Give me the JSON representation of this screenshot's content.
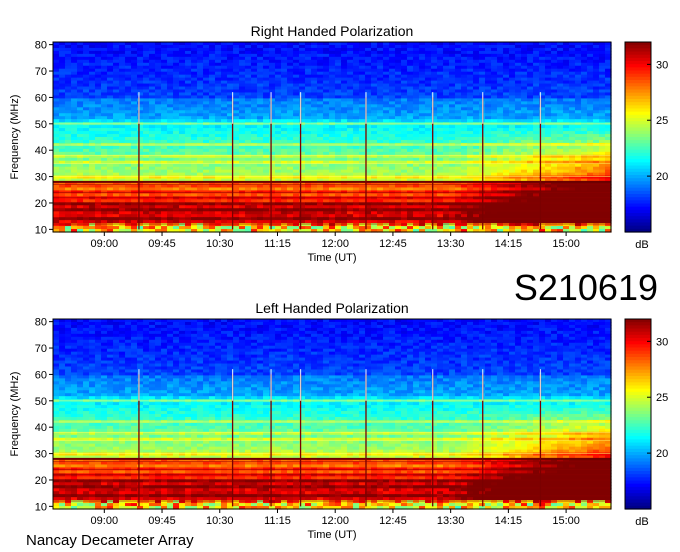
{
  "stamp": "S210619",
  "footer": "Nancay Decameter Array",
  "chart_data": [
    {
      "type": "heatmap",
      "title": "Right Handed Polarization",
      "xlabel": "Time (UT)",
      "ylabel": "Frequency (MHz)",
      "x_range": [
        "08:20",
        "15:35"
      ],
      "x_ticks": [
        "09:00",
        "09:45",
        "10:30",
        "11:15",
        "12:00",
        "12:45",
        "13:30",
        "14:15",
        "15:00"
      ],
      "ylim": [
        9,
        81
      ],
      "y_ticks": [
        10,
        20,
        30,
        40,
        50,
        60,
        70,
        80
      ],
      "colorbar": {
        "label": "dB",
        "range": [
          15,
          32
        ],
        "ticks": [
          20,
          25,
          30
        ],
        "colormap": "jet"
      },
      "features": {
        "strong_band_mhz": [
          10,
          28
        ],
        "bright_lines_mhz": [
          12,
          14,
          17,
          20,
          22,
          24,
          27,
          28,
          30,
          35,
          38,
          42,
          50
        ],
        "dark_above_mhz": 60,
        "vertical_bursts_ut": [
          "09:27",
          "10:40",
          "11:10",
          "11:33",
          "12:24",
          "13:16",
          "13:55",
          "14:40"
        ],
        "late_enhancement_from_ut": "13:30"
      }
    },
    {
      "type": "heatmap",
      "title": "Left Handed Polarization",
      "xlabel": "Time (UT)",
      "ylabel": "Frequency (MHz)",
      "x_range": [
        "08:20",
        "15:35"
      ],
      "x_ticks": [
        "09:00",
        "09:45",
        "10:30",
        "11:15",
        "12:00",
        "12:45",
        "13:30",
        "14:15",
        "15:00"
      ],
      "ylim": [
        9,
        81
      ],
      "y_ticks": [
        10,
        20,
        30,
        40,
        50,
        60,
        70,
        80
      ],
      "colorbar": {
        "label": "dB",
        "range": [
          15,
          32
        ],
        "ticks": [
          20,
          25,
          30
        ],
        "colormap": "jet"
      },
      "features": {
        "strong_band_mhz": [
          10,
          28
        ],
        "bright_lines_mhz": [
          12,
          14,
          17,
          20,
          22,
          24,
          27,
          28,
          30,
          35,
          38,
          42,
          50
        ],
        "dark_above_mhz": 60,
        "vertical_bursts_ut": [
          "09:27",
          "10:40",
          "11:10",
          "11:33",
          "12:24",
          "13:16",
          "13:55",
          "14:40"
        ],
        "late_enhancement_from_ut": "13:30"
      }
    }
  ]
}
